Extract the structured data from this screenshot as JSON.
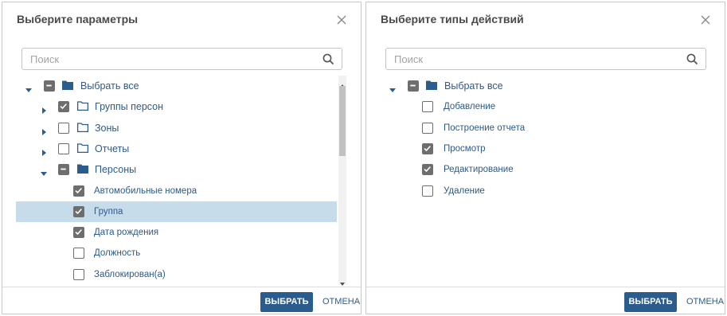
{
  "left_dialog": {
    "title": "Выберите параметры",
    "search_placeholder": "Поиск",
    "tree": {
      "root_label": "Выбрать все",
      "groups": [
        {
          "label": "Группы персон",
          "state": "checked",
          "expanded": false
        },
        {
          "label": "Зоны",
          "state": "unchecked",
          "expanded": false
        },
        {
          "label": "Отчеты",
          "state": "unchecked",
          "expanded": false
        },
        {
          "label": "Персоны",
          "state": "partial",
          "expanded": true
        }
      ],
      "person_items": [
        {
          "label": "Автомобильные номера",
          "state": "checked",
          "selected": false
        },
        {
          "label": "Группа",
          "state": "checked",
          "selected": true
        },
        {
          "label": "Дата рождения",
          "state": "checked",
          "selected": false
        },
        {
          "label": "Должность",
          "state": "unchecked",
          "selected": false
        },
        {
          "label": "Заблокирован(а)",
          "state": "unchecked",
          "selected": false
        }
      ]
    },
    "select_button": "ВЫБРАТЬ",
    "cancel_button": "ОТМЕНА"
  },
  "right_dialog": {
    "title": "Выберите типы действий",
    "search_placeholder": "Поиск",
    "tree": {
      "root_label": "Выбрать все",
      "items": [
        {
          "label": "Добавление",
          "state": "unchecked"
        },
        {
          "label": "Построение отчета",
          "state": "unchecked"
        },
        {
          "label": "Просмотр",
          "state": "checked"
        },
        {
          "label": "Редактирование",
          "state": "checked"
        },
        {
          "label": "Удаление",
          "state": "unchecked"
        }
      ]
    },
    "select_button": "ВЫБРАТЬ",
    "cancel_button": "ОТМЕНА"
  },
  "colors": {
    "primary": "#2b5c8e",
    "link_text": "#2d5a8a",
    "selected_row": "#c7dceb",
    "checkbox_fill": "#6e6e6e"
  },
  "icons": [
    "close-icon",
    "search-icon",
    "folder-icon",
    "caret-right-icon",
    "caret-down-icon",
    "checkbox-checked-icon",
    "checkbox-partial-icon"
  ]
}
